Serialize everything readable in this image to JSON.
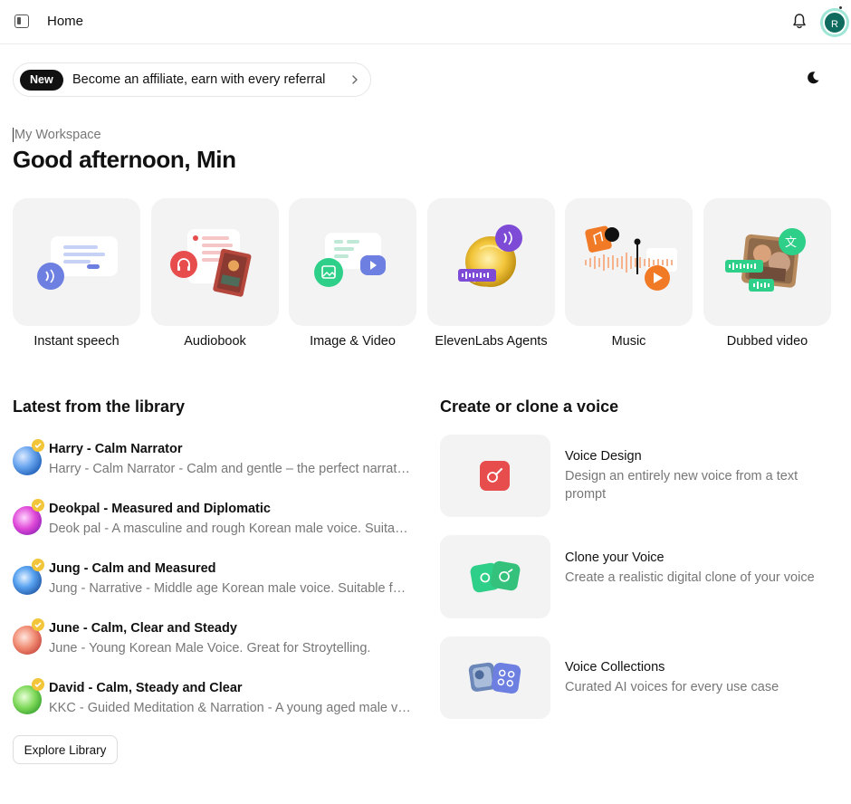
{
  "header": {
    "title": "Home",
    "avatar_initial": "R"
  },
  "banner": {
    "badge": "New",
    "text": "Become an affiliate, earn with every referral"
  },
  "workspace": {
    "label": "My Workspace",
    "greeting": "Good afternoon, Min"
  },
  "tiles": [
    {
      "label": "Instant speech"
    },
    {
      "label": "Audiobook"
    },
    {
      "label": "Image & Video"
    },
    {
      "label": "ElevenLabs Agents"
    },
    {
      "label": "Music"
    },
    {
      "label": "Dubbed video"
    }
  ],
  "library": {
    "title": "Latest from the library",
    "items": [
      {
        "name": "Harry - Calm Narrator",
        "desc": "Harry - Calm Narrator - Calm and gentle – the perfect narrator for audiobooks"
      },
      {
        "name": "Deokpal - Measured and Diplomatic",
        "desc": "Deok pal - A masculine and rough Korean male voice. Suitable for narration"
      },
      {
        "name": "Jung - Calm and Measured",
        "desc": "Jung - Narrative - Middle age Korean male voice. Suitable for audiobooks"
      },
      {
        "name": "June - Calm, Clear and Steady",
        "desc": "June - Young Korean Male Voice. Great for Stroytelling."
      },
      {
        "name": "David - Calm, Steady and Clear",
        "desc": "KKC - Guided Meditation & Narration - A young aged male voice"
      }
    ],
    "explore_label": "Explore Library"
  },
  "voice": {
    "title": "Create or clone a voice",
    "cards": [
      {
        "title": "Voice Design",
        "desc": "Design an entirely new voice from a text prompt"
      },
      {
        "title": "Clone your Voice",
        "desc": "Create a realistic digital clone of your voice"
      },
      {
        "title": "Voice Collections",
        "desc": "Curated AI voices for every use case"
      }
    ]
  },
  "colors": {
    "accent_purple": "#6d58d6",
    "accent_green": "#2ecf88",
    "accent_red": "#e84d4d",
    "accent_orange": "#f07a26"
  }
}
